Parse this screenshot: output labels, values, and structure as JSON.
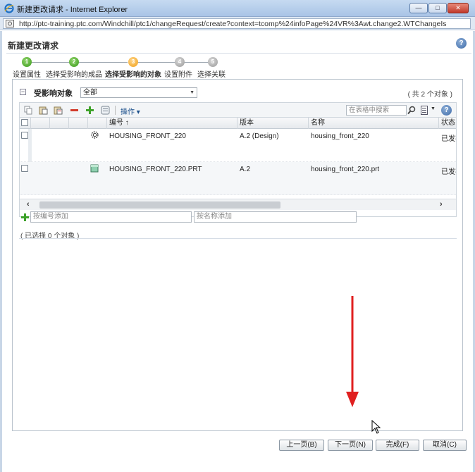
{
  "window": {
    "title": "新建更改请求 - Internet Explorer",
    "url": "http://ptc-training.ptc.com/Windchill/ptc1/changeRequest/create?context=tcomp%24infoPage%24VR%3Awt.change2.WTChangeIs",
    "controls": {
      "minimize": "—",
      "maximize": "□",
      "close": "✕"
    }
  },
  "dialog": {
    "title": "新建更改请求",
    "help_icon": "?",
    "steps": [
      {
        "number": "1",
        "label": "设置属性",
        "state": "done"
      },
      {
        "number": "2",
        "label": "选择受影响的成品",
        "state": "done"
      },
      {
        "number": "3",
        "label": "选择受影响的对象",
        "state": "current"
      },
      {
        "number": "4",
        "label": "设置附件",
        "state": "todo"
      },
      {
        "number": "5",
        "label": "选择关联",
        "state": "todo"
      }
    ]
  },
  "affected_objects": {
    "title": "受影响对象",
    "collapse_glyph": "−",
    "filter_value": "全部",
    "object_count": "( 共 2 个对象 )",
    "toolbar": {
      "actions_label": "操作 ▾",
      "search_placeholder": "在表格中搜索",
      "help": "?"
    },
    "columns": [
      "编号 ↑",
      "版本",
      "名称",
      "状态"
    ],
    "rows": [
      {
        "number": "HOUSING_FRONT_220",
        "version": "A.2 (Design)",
        "name": "housing_front_220",
        "status": "已发布",
        "icon": "gear-icon"
      },
      {
        "number": "HOUSING_FRONT_220.PRT",
        "version": "A.2",
        "name": "housing_front_220.prt",
        "status": "已发布",
        "icon": "part-icon"
      }
    ],
    "add_by_number_placeholder": "按编号添加",
    "add_by_name_placeholder": "按名称添加",
    "selected_count": "( 已选择 0 个对象 )",
    "scroll_left": "‹",
    "scroll_right": "›"
  },
  "footer": {
    "back": "上一页(B)",
    "next": "下一页(N)",
    "finish": "完成(F)",
    "cancel": "取消(C)"
  },
  "colors": {
    "accent": "#1a4f8b",
    "step_done": "#3b9a1c",
    "step_current": "#f0a01a",
    "annotation_arrow": "#e02020"
  }
}
